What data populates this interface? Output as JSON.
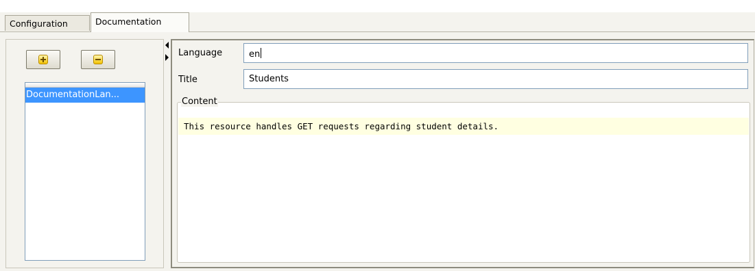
{
  "tabs": [
    {
      "label": "Configuration",
      "active": false
    },
    {
      "label": "Documentation",
      "active": true
    }
  ],
  "left_panel": {
    "add_icon": "plus-icon",
    "remove_icon": "minus-icon",
    "list_items": [
      "DocumentationLan..."
    ]
  },
  "form": {
    "language_label": "Language",
    "language_value": "en",
    "title_label": "Title",
    "title_value": "Students",
    "content_label": "Content",
    "content_text": "This resource handles GET requests regarding student details."
  },
  "colors": {
    "selection": "#3d95ff",
    "content_highlight": "#ffffe1",
    "panel_bg": "#f4f3ee"
  }
}
